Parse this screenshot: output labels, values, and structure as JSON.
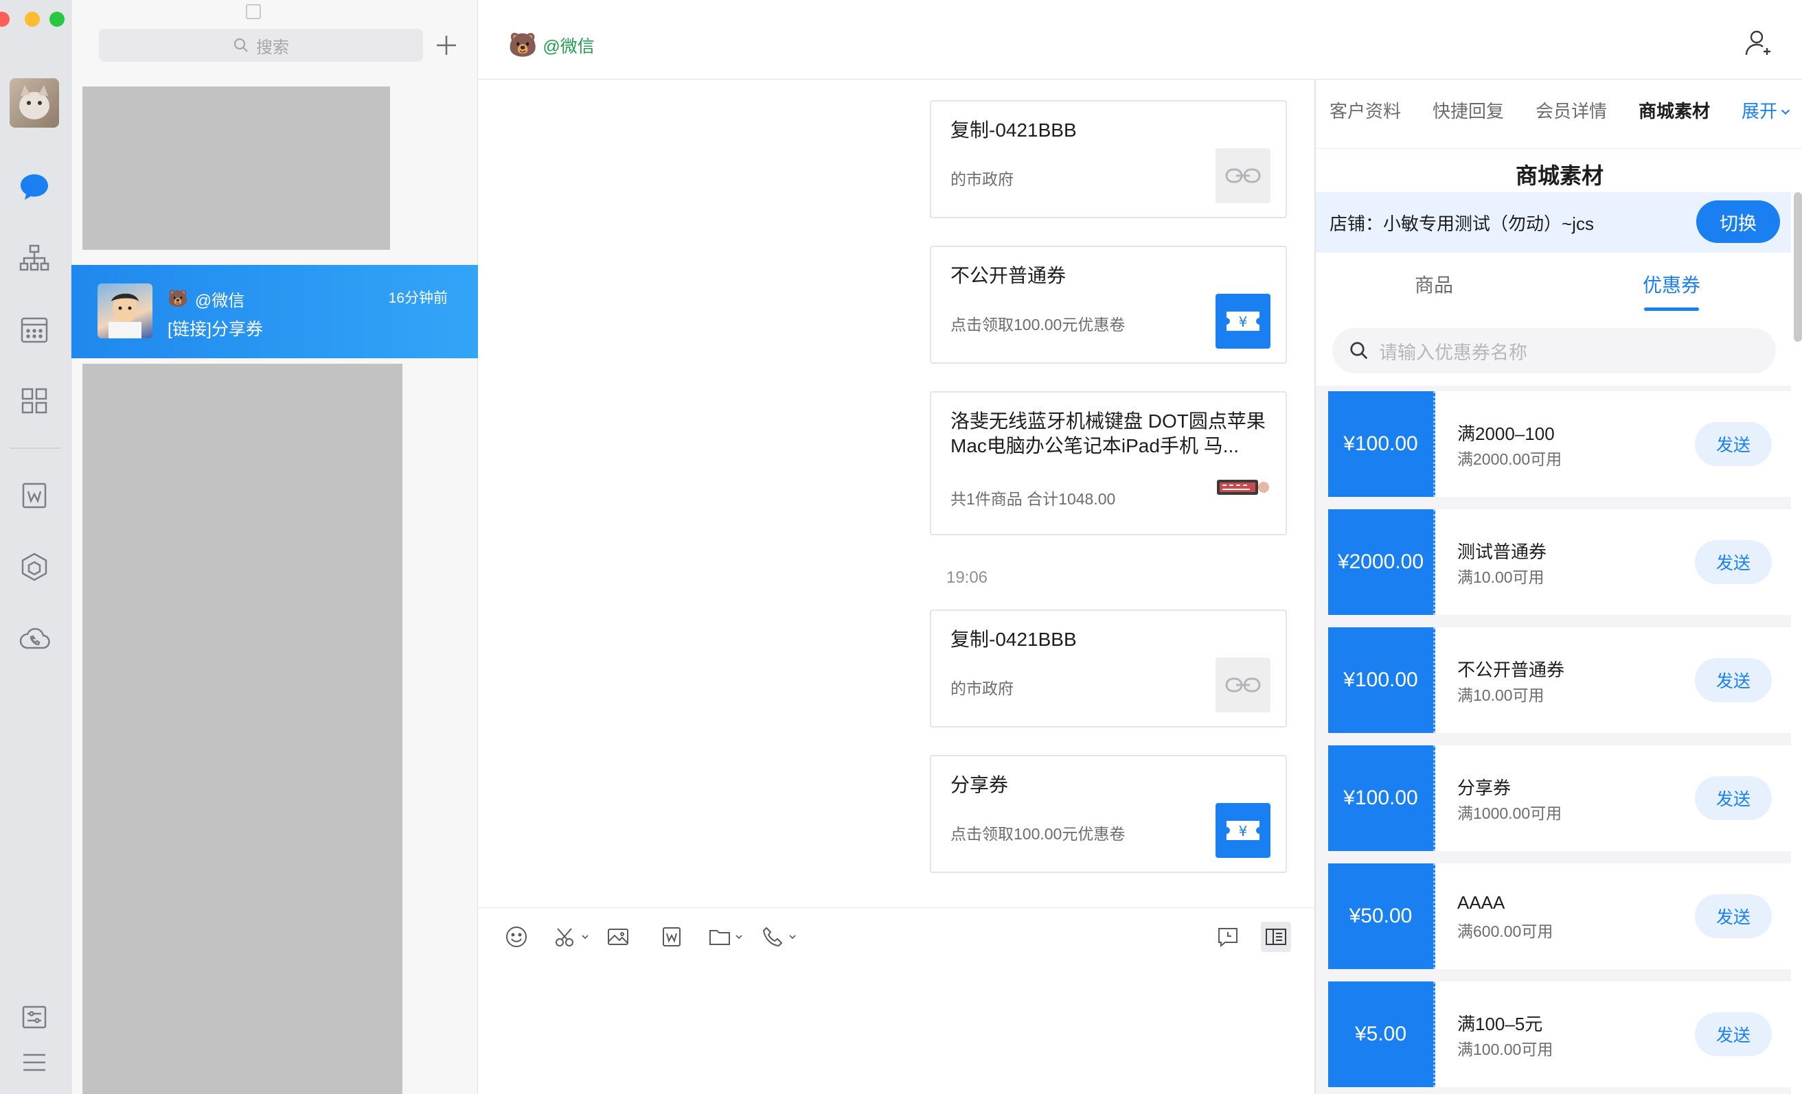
{
  "search": {
    "placeholder": "搜索"
  },
  "conversation": {
    "active": {
      "name_emoji": "🐻",
      "name": "@微信",
      "time": "16分钟前",
      "last_message": "[链接]分享券"
    }
  },
  "chat": {
    "header_emoji": "🐻",
    "header_title": "@微信",
    "time_separator": "19:06",
    "cards": [
      {
        "title": "复制-0421BBB",
        "subtitle": "的市政府",
        "thumb": "link-icon"
      },
      {
        "title": "不公开普通券",
        "subtitle": "点击领取100.00元优惠卷",
        "thumb": "coupon-icon"
      },
      {
        "title": "洛斐无线蓝牙机械键盘 DOT圆点苹果Mac电脑办公笔记本iPad手机 马...",
        "subtitle": "共1件商品 合计1048.00",
        "thumb": "keyboard-image"
      },
      {
        "title": "复制-0421BBB",
        "subtitle": "的市政府",
        "thumb": "link-icon"
      },
      {
        "title": "分享券",
        "subtitle": "点击领取100.00元优惠卷",
        "thumb": "coupon-icon"
      }
    ]
  },
  "panel": {
    "tabs": [
      "客户资料",
      "快捷回复",
      "会员详情",
      "商城素材"
    ],
    "expand": "展开",
    "title": "商城素材",
    "store_label": "店铺：小敏专用测试（勿动）~jcs",
    "switch_button": "切换",
    "sub_tabs": {
      "goods": "商品",
      "coupons": "优惠券"
    },
    "coupon_search_placeholder": "请输入优惠券名称",
    "send_label": "发送",
    "coupons": [
      {
        "amount": "¥100.00",
        "name": "满2000–100",
        "condition": "满2000.00可用"
      },
      {
        "amount": "¥2000.00",
        "name": "测试普通券",
        "condition": "满10.00可用"
      },
      {
        "amount": "¥100.00",
        "name": "不公开普通券",
        "condition": "满10.00可用"
      },
      {
        "amount": "¥100.00",
        "name": "分享券",
        "condition": "满1000.00可用"
      },
      {
        "amount": "¥50.00",
        "name": "AAAA",
        "condition": "满600.00可用"
      },
      {
        "amount": "¥5.00",
        "name": "满100–5元",
        "condition": "满100.00可用"
      }
    ]
  },
  "colors": {
    "accent": "#1a7ff0",
    "active_conv": "#1f88ee",
    "contact_name": "#1e9e4c"
  }
}
